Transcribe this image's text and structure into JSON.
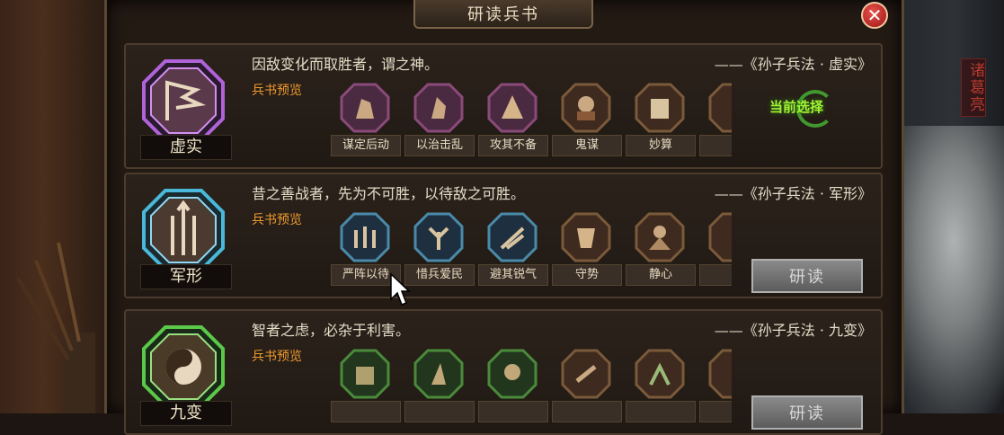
{
  "window": {
    "title": "研读兵书",
    "close_icon": "close-icon"
  },
  "side": {
    "character_name": "诸葛亮"
  },
  "books": [
    {
      "emblem_label": "虚实",
      "emblem_color": "#9b3fb8",
      "emblem_icon": "banner-icon",
      "quote": "因敌变化而取胜者，谓之神。",
      "source": "——《孙子兵法 · 虚实》",
      "preview_label": "兵书预览",
      "skills": [
        "谋定后动",
        "以治击乱",
        "攻其不备",
        "鬼谋",
        "妙算",
        ""
      ],
      "action": {
        "type": "status",
        "label": "当前选择"
      }
    },
    {
      "emblem_label": "军形",
      "emblem_color": "#3aa3c8",
      "emblem_icon": "arrows-icon",
      "quote": "昔之善战者，先为不可胜，以待敌之可胜。",
      "source": "——《孙子兵法 · 军形》",
      "preview_label": "兵书预览",
      "skills": [
        "严阵以待",
        "惜兵爱民",
        "避其锐气",
        "守势",
        "静心",
        ""
      ],
      "action": {
        "type": "button",
        "label": "研读"
      }
    },
    {
      "emblem_label": "九变",
      "emblem_color": "#4fb83a",
      "emblem_icon": "yin-yang-icon",
      "quote": "智者之虑，必杂于利害。",
      "source": "——《孙子兵法 · 九变》",
      "preview_label": "兵书预览",
      "skills": [
        "",
        "",
        "",
        "",
        "",
        ""
      ],
      "action": {
        "type": "button",
        "label": "研读"
      }
    }
  ]
}
